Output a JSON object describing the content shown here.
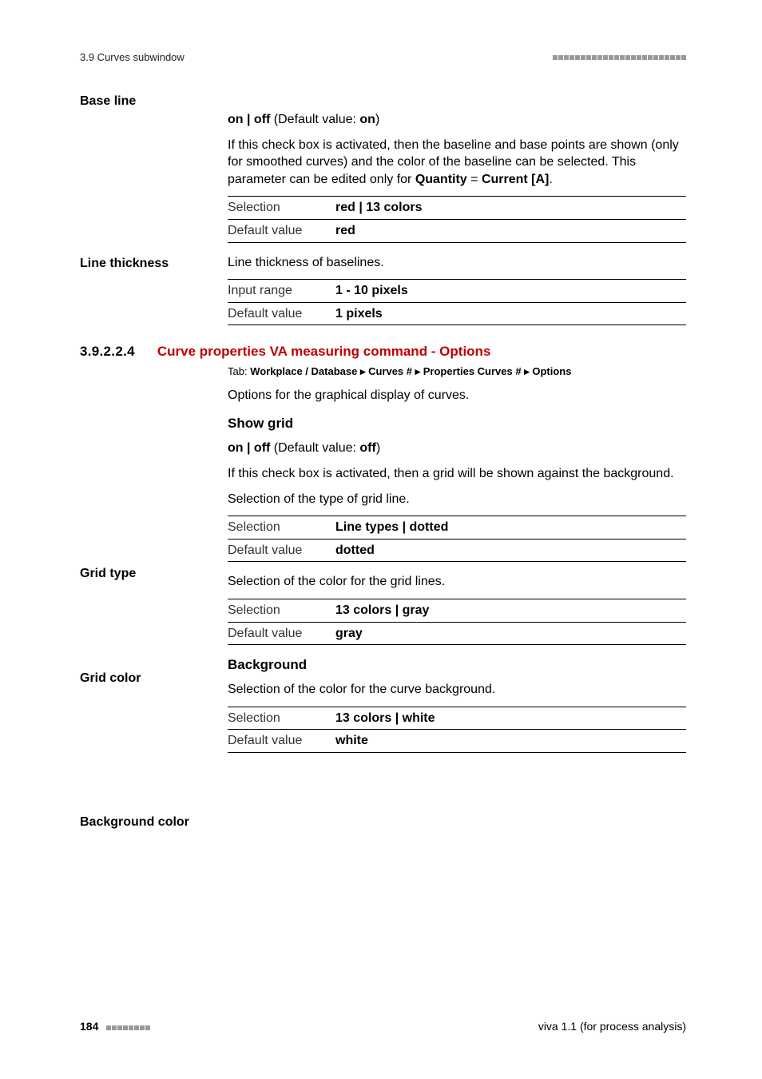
{
  "header": {
    "left": "3.9 Curves subwindow"
  },
  "baseline": {
    "label": "Base line",
    "toggle": {
      "prefix": "on | off",
      "mid": " (Default value: ",
      "val": "on",
      "suffix": ")"
    },
    "desc1": "If this check box is activated, then the baseline and base points are shown (only for smoothed curves) and the color of the baseline can be selected. This parameter can be edited only for ",
    "desc_b1": "Quantity",
    "desc_eq": " = ",
    "desc_b2": "Current [A]",
    "desc_end": ".",
    "row1k": "Selection",
    "row1v": "red | 13 colors",
    "row2k": "Default value",
    "row2v": "red"
  },
  "linethickness": {
    "label": "Line thickness",
    "desc": "Line thickness of baselines.",
    "row1k": "Input range",
    "row1v": "1 - 10 pixels",
    "row2k": "Default value",
    "row2v": "1 pixels"
  },
  "section": {
    "num": "3.9.2.2.4",
    "title": "Curve properties VA measuring command - Options",
    "tab_prefix": "Tab: ",
    "tab_body": "Workplace / Database ▸ Curves # ▸ Properties Curves # ▸ Options",
    "intro": "Options for the graphical display of curves."
  },
  "showgrid": {
    "head": "Show grid",
    "toggle": {
      "prefix": "on | off",
      "mid": " (Default value: ",
      "val": "off",
      "suffix": ")"
    },
    "desc": "If this check box is activated, then a grid will be shown against the background."
  },
  "gridtype": {
    "label": "Grid type",
    "desc": "Selection of the type of grid line.",
    "row1k": "Selection",
    "row1v": "Line types | dotted",
    "row2k": "Default value",
    "row2v": "dotted"
  },
  "gridcolor": {
    "label": "Grid color",
    "desc": "Selection of the color for the grid lines.",
    "row1k": "Selection",
    "row1v": "13 colors | gray",
    "row2k": "Default value",
    "row2v": "gray"
  },
  "background": {
    "head": "Background"
  },
  "bgcolor": {
    "label": "Background color",
    "desc": "Selection of the color for the curve background.",
    "row1k": "Selection",
    "row1v": "13 colors | white",
    "row2k": "Default value",
    "row2v": "white"
  },
  "footer": {
    "page": "184",
    "right": "viva 1.1 (for process analysis)"
  }
}
